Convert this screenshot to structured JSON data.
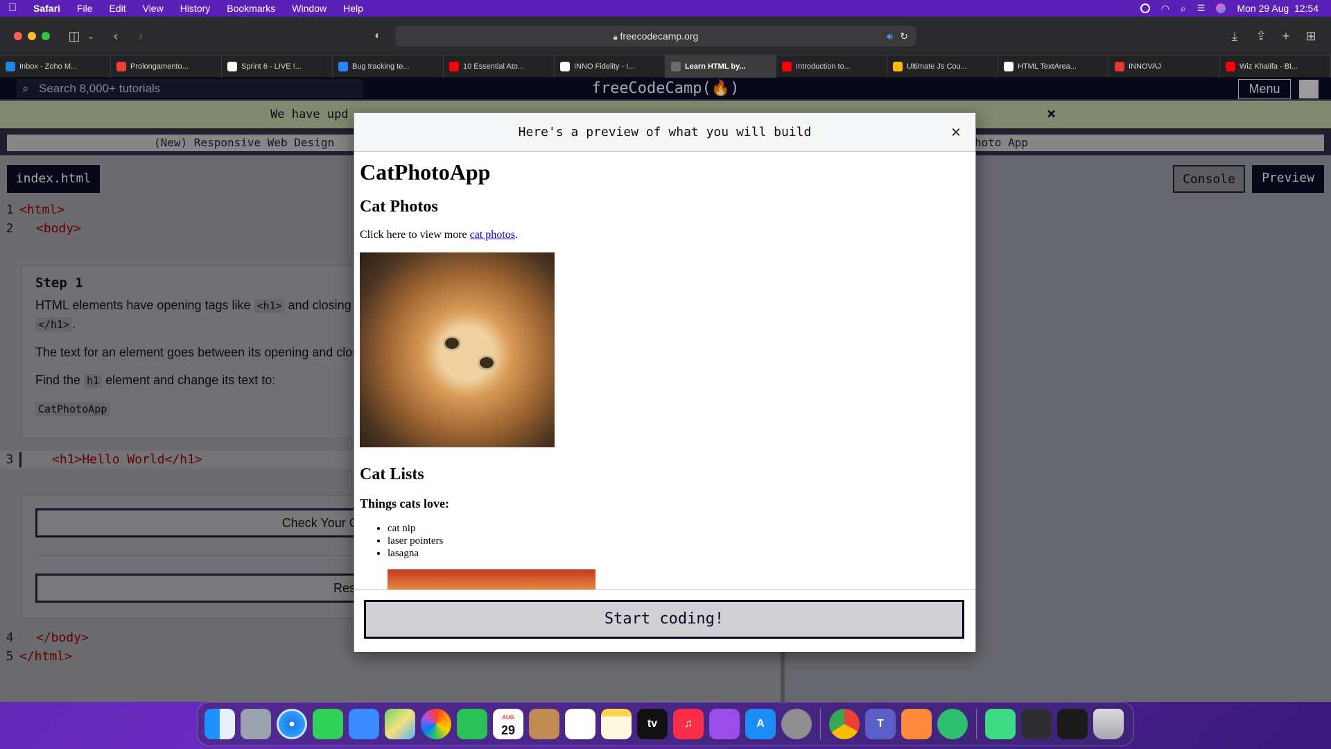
{
  "menubar": {
    "items": [
      "Safari",
      "File",
      "Edit",
      "View",
      "History",
      "Bookmarks",
      "Window",
      "Help"
    ],
    "datetime": "Mon 29 Aug  12:54"
  },
  "browser": {
    "address": "freecodecamp.org",
    "tabs": [
      {
        "label": "Inbox - Zoho M...",
        "color": "#1e88e5"
      },
      {
        "label": "Prolongamento...",
        "color": "#ea4335"
      },
      {
        "label": "Sprint 6 - LIVE !...",
        "color": "#ffffff"
      },
      {
        "label": "Bug tracking te...",
        "color": "#2684ff"
      },
      {
        "label": "10 Essential Ato...",
        "color": "#ff0000"
      },
      {
        "label": "INNO Fidelity - I...",
        "color": "#ffffff"
      },
      {
        "label": "Learn HTML by...",
        "color": "#6b6b6b",
        "active": true
      },
      {
        "label": "Introduction to...",
        "color": "#ff0000"
      },
      {
        "label": "Ultimate Js Cou...",
        "color": "#fbbc04"
      },
      {
        "label": "HTML TextArea...",
        "color": "#ffffff"
      },
      {
        "label": "INNOVAJ",
        "color": "#e53935"
      },
      {
        "label": "Wiz Khalifa - Bl...",
        "color": "#ff0000"
      }
    ]
  },
  "fcc": {
    "search_placeholder": "Search 8,000+ tutorials",
    "logo": "freeCodeCamp(🔥)",
    "menu": "Menu",
    "banner": "We have upd",
    "banner_close": "×",
    "crumb_left": "(New) Responsive Web Design",
    "crumb_right": "hoto App",
    "file_tab": "index.html",
    "console": "Console",
    "preview": "Preview"
  },
  "code": {
    "line1": {
      "num": "1",
      "text": "<html>"
    },
    "line2": {
      "num": "2",
      "text": "<body>"
    },
    "line3": {
      "num": "3",
      "text": "<h1>Hello World</h1>"
    },
    "line4": {
      "num": "4",
      "text": "</body>"
    },
    "line5": {
      "num": "5",
      "text": "</html>"
    }
  },
  "step": {
    "title": "Step 1",
    "p1_a": "HTML elements have opening tags like ",
    "p1_chip1": "<h1>",
    "p1_b": " and closing ta",
    "p1_chip2": "</h1>",
    "p1_c": ".",
    "p2": "The text for an element goes between its opening and closi",
    "p3_a": "Find the ",
    "p3_chip": "h1",
    "p3_b": " element and change its text to:",
    "answer": "CatPhotoApp",
    "check_btn": "Check Your Code (Ctrl + Enter)",
    "restart_btn": "Restart Step"
  },
  "modal": {
    "title": "Here's a preview of what you will build",
    "close": "×",
    "h1": "CatPhotoApp",
    "h2a": "Cat Photos",
    "p_prefix": "Click here to view more ",
    "p_link": "cat photos",
    "p_suffix": ".",
    "h2b": "Cat Lists",
    "h3": "Things cats love:",
    "list": [
      "cat nip",
      "laser pointers",
      "lasagna"
    ],
    "start_btn": "Start coding!"
  },
  "dock": {
    "calendar_month": "AUG",
    "calendar_day": "29",
    "tv_label": "tv"
  }
}
